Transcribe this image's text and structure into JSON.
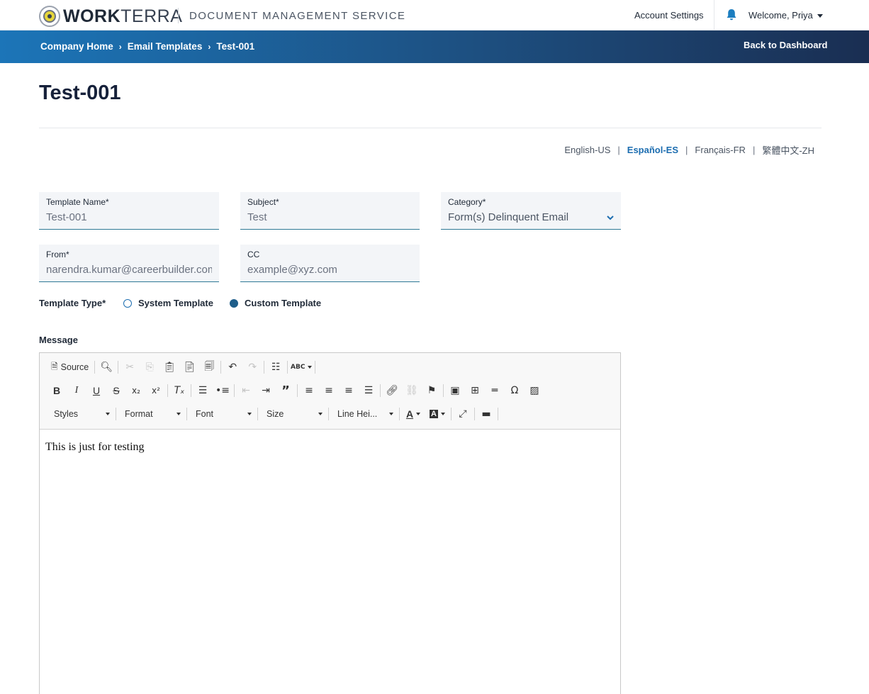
{
  "brand": {
    "logo_bold": "WORK",
    "logo_light": "TERRA",
    "service": "DOCUMENT MANAGEMENT SERVICE"
  },
  "header": {
    "account_settings": "Account Settings",
    "welcome": "Welcome, Priya"
  },
  "breadcrumb": {
    "items": [
      "Company Home",
      "Email Templates",
      "Test-001"
    ],
    "back_link": "Back to Dashboard"
  },
  "page": {
    "title": "Test-001"
  },
  "languages": [
    "English-US",
    "Español-ES",
    "Français-FR",
    "繁體中文-ZH"
  ],
  "active_language": "Español-ES",
  "form": {
    "template_name": {
      "label": "Template Name*",
      "value": "Test-001"
    },
    "subject": {
      "label": "Subject*",
      "value": "Test"
    },
    "category": {
      "label": "Category*",
      "value": "Form(s) Delinquent Email"
    },
    "from": {
      "label": "From*",
      "value": "narendra.kumar@careerbuilder.com"
    },
    "cc": {
      "label": "CC",
      "placeholder": "example@xyz.com"
    },
    "template_type": {
      "label": "Template Type*",
      "options": [
        "System Template",
        "Custom Template"
      ],
      "selected": "Custom Template"
    },
    "message_label": "Message"
  },
  "editor": {
    "source_label": "Source",
    "combos": [
      "Styles",
      "Format",
      "Font",
      "Size",
      "Line Hei..."
    ],
    "content": "This is just for testing"
  },
  "colors": {
    "accent": "#1c6db0",
    "header_gradient_start": "#1c75b8",
    "header_gradient_end": "#1a2e52",
    "field_bg": "#f3f5f8"
  }
}
